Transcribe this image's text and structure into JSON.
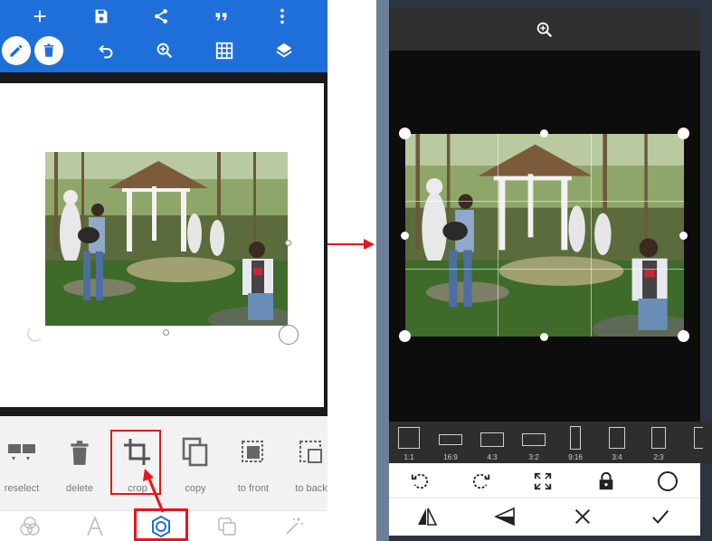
{
  "left_screen": {
    "toolbar_row1_icons": [
      "add-icon",
      "save-icon",
      "share-icon",
      "quote-icon",
      "more-vert-icon"
    ],
    "toolbar_row2_icons": [
      "pencil-icon",
      "trash-icon",
      "undo-icon",
      "zoom-in-icon",
      "grid-icon",
      "layers-icon"
    ],
    "tools": [
      {
        "label": "reselect",
        "icon": "reselect-icon"
      },
      {
        "label": "delete",
        "icon": "trash-icon"
      },
      {
        "label": "crop",
        "icon": "crop-icon"
      },
      {
        "label": "copy",
        "icon": "copy-icon"
      },
      {
        "label": "to front",
        "icon": "to-front-icon"
      },
      {
        "label": "to back",
        "icon": "to-back-icon"
      }
    ],
    "bottom_nav_icons": [
      "color-icon",
      "text-icon",
      "shape-icon",
      "sticker-icon",
      "magic-icon"
    ],
    "highlight_color": "#e4161b",
    "accent_color": "#1e6fd9"
  },
  "right_screen": {
    "top_icon": "zoom-in-icon",
    "ratios": [
      {
        "label": "1:1"
      },
      {
        "label": "16:9"
      },
      {
        "label": "4:3"
      },
      {
        "label": "3:2"
      },
      {
        "label": "9:16"
      },
      {
        "label": "3:4"
      },
      {
        "label": "2:3"
      }
    ],
    "action_row1_icons": [
      "rotate-left-icon",
      "rotate-right-icon",
      "expand-icon",
      "lock-icon",
      "circle-icon"
    ],
    "action_row2_icons": [
      "flip-horizontal-icon",
      "flip-vertical-icon",
      "cancel-icon",
      "confirm-icon"
    ]
  }
}
